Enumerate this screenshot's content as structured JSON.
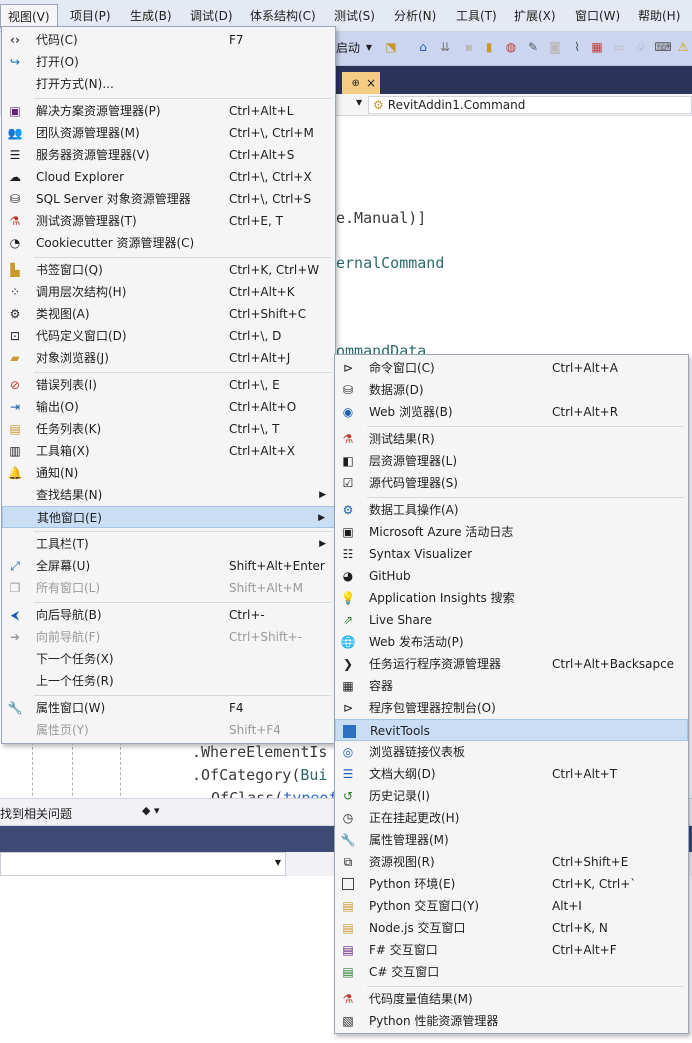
{
  "menubar": {
    "items": [
      "视图(V)",
      "项目(P)",
      "生成(B)",
      "调试(D)",
      "体系结构(C)",
      "测试(S)",
      "分析(N)",
      "工具(T)",
      "扩展(X)",
      "窗口(W)",
      "帮助(H)"
    ]
  },
  "toolbar": {
    "config_label": "启动"
  },
  "editor": {
    "tab_close": "×",
    "member_dropdown": "RevitAddin1.Command",
    "code_fragments": {
      "manual": "e.Manual)]",
      "external": "ernalCommand",
      "commanddata": "ommandData",
      "where_element": ".WhereElementIs",
      "of_category_prefix": ".OfCategory(",
      "of_category_rest": "Bui",
      "of_class_prefix": ".OfClass(",
      "of_class_rest": "typeof"
    }
  },
  "error_list_bar": {
    "text": "找到相关问题"
  },
  "view_menu": {
    "items": [
      {
        "label": "代码(C)",
        "shortcut": "F7",
        "icon": "code-icon"
      },
      {
        "label": "打开(O)",
        "shortcut": "",
        "icon": "open-arrow-icon"
      },
      {
        "label": "打开方式(N)...",
        "shortcut": "",
        "icon": ""
      },
      {
        "label": "解决方案资源管理器(P)",
        "shortcut": "Ctrl+Alt+L",
        "icon": "solution-explorer-icon"
      },
      {
        "label": "团队资源管理器(M)",
        "shortcut": "Ctrl+\\, Ctrl+M",
        "icon": "team-explorer-icon"
      },
      {
        "label": "服务器资源管理器(V)",
        "shortcut": "Ctrl+Alt+S",
        "icon": "server-explorer-icon"
      },
      {
        "label": "Cloud Explorer",
        "shortcut": "Ctrl+\\, Ctrl+X",
        "icon": "cloud-icon"
      },
      {
        "label": "SQL Server 对象资源管理器",
        "shortcut": "Ctrl+\\, Ctrl+S",
        "icon": "sql-server-icon"
      },
      {
        "label": "测试资源管理器(T)",
        "shortcut": "Ctrl+E, T",
        "icon": "test-explorer-icon"
      },
      {
        "label": "Cookiecutter 资源管理器(C)",
        "shortcut": "",
        "icon": "cookiecutter-icon"
      },
      {
        "label": "书签窗口(Q)",
        "shortcut": "Ctrl+K, Ctrl+W",
        "icon": "bookmark-icon"
      },
      {
        "label": "调用层次结构(H)",
        "shortcut": "Ctrl+Alt+K",
        "icon": "call-hierarchy-icon"
      },
      {
        "label": "类视图(A)",
        "shortcut": "Ctrl+Shift+C",
        "icon": "class-view-icon"
      },
      {
        "label": "代码定义窗口(D)",
        "shortcut": "Ctrl+\\, D",
        "icon": "code-definition-icon"
      },
      {
        "label": "对象浏览器(J)",
        "shortcut": "Ctrl+Alt+J",
        "icon": "object-browser-icon"
      },
      {
        "label": "错误列表(I)",
        "shortcut": "Ctrl+\\, E",
        "icon": "error-list-icon"
      },
      {
        "label": "输出(O)",
        "shortcut": "Ctrl+Alt+O",
        "icon": "output-icon"
      },
      {
        "label": "任务列表(K)",
        "shortcut": "Ctrl+\\, T",
        "icon": "task-list-icon"
      },
      {
        "label": "工具箱(X)",
        "shortcut": "Ctrl+Alt+X",
        "icon": "toolbox-icon"
      },
      {
        "label": "通知(N)",
        "shortcut": "",
        "icon": "bell-icon"
      },
      {
        "label": "查找结果(N)",
        "shortcut": "",
        "icon": ""
      },
      {
        "label": "其他窗口(E)",
        "shortcut": "",
        "icon": ""
      },
      {
        "label": "工具栏(T)",
        "shortcut": "",
        "icon": ""
      },
      {
        "label": "全屏幕(U)",
        "shortcut": "Shift+Alt+Enter",
        "icon": "fullscreen-icon"
      },
      {
        "label": "所有窗口(L)",
        "shortcut": "Shift+Alt+M",
        "icon": "all-windows-icon"
      },
      {
        "label": "向后导航(B)",
        "shortcut": "Ctrl+-",
        "icon": "navigate-back-icon"
      },
      {
        "label": "向前导航(F)",
        "shortcut": "Ctrl+Shift+-",
        "icon": "navigate-forward-icon"
      },
      {
        "label": "下一个任务(X)",
        "shortcut": "",
        "icon": ""
      },
      {
        "label": "上一个任务(R)",
        "shortcut": "",
        "icon": ""
      },
      {
        "label": "属性窗口(W)",
        "shortcut": "F4",
        "icon": "wrench-icon"
      },
      {
        "label": "属性页(Y)",
        "shortcut": "Shift+F4",
        "icon": ""
      }
    ]
  },
  "other_windows_menu": {
    "items": [
      {
        "label": "命令窗口(C)",
        "shortcut": "Ctrl+Alt+A",
        "icon": "command-window-icon"
      },
      {
        "label": "数据源(D)",
        "shortcut": "",
        "icon": "data-sources-icon"
      },
      {
        "label": "Web 浏览器(B)",
        "shortcut": "Ctrl+Alt+R",
        "icon": "web-browser-icon"
      },
      {
        "label": "测试结果(R)",
        "shortcut": "",
        "icon": "test-results-icon"
      },
      {
        "label": "层资源管理器(L)",
        "shortcut": "",
        "icon": "layer-explorer-icon"
      },
      {
        "label": "源代码管理器(S)",
        "shortcut": "",
        "icon": "source-control-icon"
      },
      {
        "label": "数据工具操作(A)",
        "shortcut": "",
        "icon": "data-tools-icon"
      },
      {
        "label": "Microsoft Azure 活动日志",
        "shortcut": "",
        "icon": "azure-log-icon"
      },
      {
        "label": "Syntax Visualizer",
        "shortcut": "",
        "icon": "syntax-visualizer-icon"
      },
      {
        "label": "GitHub",
        "shortcut": "",
        "icon": "github-icon"
      },
      {
        "label": "Application Insights 搜索",
        "shortcut": "",
        "icon": "lightbulb-icon"
      },
      {
        "label": "Live Share",
        "shortcut": "",
        "icon": "live-share-icon"
      },
      {
        "label": "Web 发布活动(P)",
        "shortcut": "",
        "icon": "globe-icon"
      },
      {
        "label": "任务运行程序资源管理器",
        "shortcut": "Ctrl+Alt+Backsapce",
        "icon": "chevron-right-icon"
      },
      {
        "label": "容器",
        "shortcut": "",
        "icon": "container-icon"
      },
      {
        "label": "程序包管理器控制台(O)",
        "shortcut": "",
        "icon": "console-icon"
      },
      {
        "label": "RevitTools",
        "shortcut": "",
        "icon": "revittools-icon"
      },
      {
        "label": "浏览器链接仪表板",
        "shortcut": "",
        "icon": "browser-link-icon"
      },
      {
        "label": "文档大纲(D)",
        "shortcut": "Ctrl+Alt+T",
        "icon": "document-outline-icon"
      },
      {
        "label": "历史记录(I)",
        "shortcut": "",
        "icon": "history-icon"
      },
      {
        "label": "正在挂起更改(H)",
        "shortcut": "",
        "icon": "clock-icon"
      },
      {
        "label": "属性管理器(M)",
        "shortcut": "",
        "icon": "wrench-icon"
      },
      {
        "label": "资源视图(R)",
        "shortcut": "Ctrl+Shift+E",
        "icon": "resource-view-icon"
      },
      {
        "label": "Python 环境(E)",
        "shortcut": "Ctrl+K, Ctrl+`",
        "icon": "python-env-icon"
      },
      {
        "label": "Python 交互窗口(Y)",
        "shortcut": "Alt+I",
        "icon": "python-interactive-icon"
      },
      {
        "label": "Node.js 交互窗口",
        "shortcut": "Ctrl+K, N",
        "icon": "nodejs-interactive-icon"
      },
      {
        "label": "F# 交互窗口",
        "shortcut": "Ctrl+Alt+F",
        "icon": "fsharp-interactive-icon"
      },
      {
        "label": "C# 交互窗口",
        "shortcut": "",
        "icon": "csharp-interactive-icon"
      },
      {
        "label": "代码度量值结果(M)",
        "shortcut": "",
        "icon": "code-metrics-icon"
      },
      {
        "label": "Python 性能资源管理器",
        "shortcut": "",
        "icon": "python-perf-icon"
      }
    ]
  },
  "colors": {
    "accent": "#c9def5",
    "titlebar": "#2a3358",
    "tab_active": "#f5cc84"
  }
}
